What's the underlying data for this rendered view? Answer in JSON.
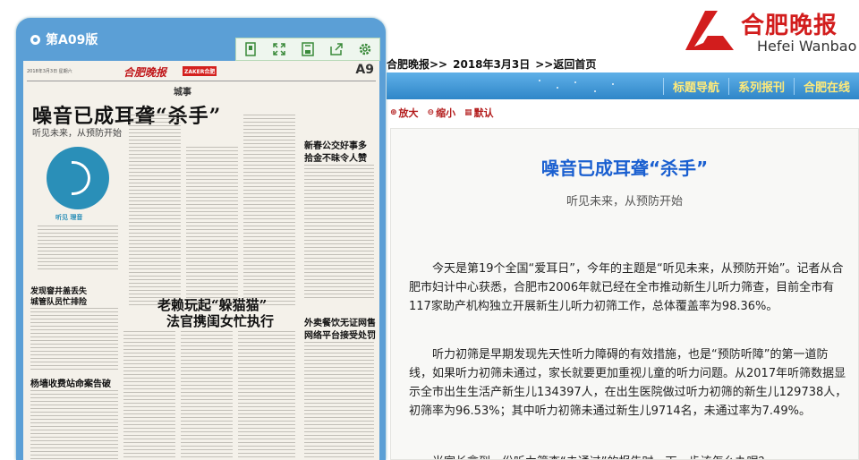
{
  "reader": {
    "edition_label": "第A09版",
    "tools": [
      "page-icon",
      "fullscreen-icon",
      "save-icon",
      "share-icon",
      "settings-icon"
    ],
    "paper": {
      "date_line": "2018年3月3日 星期六",
      "masthead": "合肥晚报",
      "partner": "ZAKER合肥",
      "page_no": "A9",
      "section": "城事",
      "headline": "噪音已成耳聋“杀手”",
      "subhead": "听见未来，从预防开始",
      "logo_caption": "听见 理音",
      "headline2": "老赖玩起“躲猫猫”",
      "headline2b": "法官携闺女忙执行",
      "side_head1": "新春公交好事多",
      "side_head1b": "拾金不昧令人赞",
      "side_head2": "外卖餐饮无证网售",
      "side_head2b": "网络平台接受处罚",
      "left_head1": "发现窨井盖丢失",
      "left_head1b": "城管队员忙排险",
      "left_head2": "杨墙收费站命案告破"
    }
  },
  "brand": {
    "name_cn": "合肥晚报",
    "name_en": "Hefei Wanbao",
    "color": "#d21d1d"
  },
  "breadcrumb": {
    "site": "合肥晚报>>",
    "date": "2018年3月3日",
    "back": ">>返回首页"
  },
  "nav": {
    "items": [
      "标题导航",
      "系列报刊",
      "合肥在线"
    ],
    "color": "#ffea7a"
  },
  "zoom": {
    "zoom_in": "放大",
    "zoom_out": "缩小",
    "default": "默认"
  },
  "article": {
    "title": "噪音已成耳聋“杀手”",
    "subtitle": "听见未来，从预防开始",
    "paragraphs": [
      "今天是第19个全国“爱耳日”，今年的主题是“听见未来，从预防开始”。记者从合肥市妇计中心获悉，合肥市2006年就已经在全市推动新生儿听力筛查，目前全市有117家助产机构独立开展新生儿听力初筛工作，总体覆盖率为98.36%。",
      "听力初筛是早期发现先天性听力障碍的有效措施，也是“预防听障”的第一道防线，如果听力初筛未通过，家长就要更加重视儿童的听力问题。从2017年听筛数据显示全市出生生活产新生儿134397人，在出生医院做过听力初筛的新生儿129738人，初筛率为96.53%；其中听力初筛未通过新生儿9714名，未通过率为7.49%。",
      "当家长拿到一份听力筛查“未通过”的报告时，下一步该怎么办呢？"
    ]
  }
}
